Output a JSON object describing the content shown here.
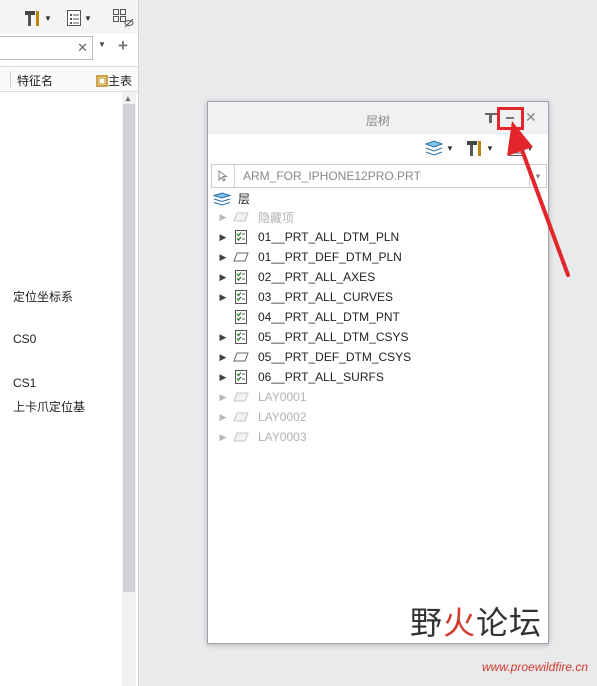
{
  "left_panel": {
    "column_feature_label": "特征名",
    "column_main_label": "主表",
    "items": [
      "定位坐标系",
      "CS0",
      "CS1",
      "上卡爪定位基"
    ]
  },
  "dialog": {
    "title": "层树",
    "model_name": "ARM_FOR_IPHONE12PRO.PRT",
    "root_label": "层",
    "layers": [
      {
        "label": "隐藏项",
        "expandable": true,
        "dimmed": true,
        "icon": "plane-icon"
      },
      {
        "label": "01__PRT_ALL_DTM_PLN",
        "expandable": true,
        "dimmed": false,
        "icon": "layer-rule-icon"
      },
      {
        "label": "01__PRT_DEF_DTM_PLN",
        "expandable": true,
        "dimmed": false,
        "icon": "plane-icon"
      },
      {
        "label": "02__PRT_ALL_AXES",
        "expandable": true,
        "dimmed": false,
        "icon": "layer-rule-icon"
      },
      {
        "label": "03__PRT_ALL_CURVES",
        "expandable": true,
        "dimmed": false,
        "icon": "layer-rule-icon"
      },
      {
        "label": "04__PRT_ALL_DTM_PNT",
        "expandable": false,
        "dimmed": false,
        "icon": "layer-rule-icon"
      },
      {
        "label": "05__PRT_ALL_DTM_CSYS",
        "expandable": true,
        "dimmed": false,
        "icon": "layer-rule-icon"
      },
      {
        "label": "05__PRT_DEF_DTM_CSYS",
        "expandable": true,
        "dimmed": false,
        "icon": "plane-icon"
      },
      {
        "label": "06__PRT_ALL_SURFS",
        "expandable": true,
        "dimmed": false,
        "icon": "layer-rule-icon"
      },
      {
        "label": "LAY0001",
        "expandable": true,
        "dimmed": true,
        "icon": "plane-icon"
      },
      {
        "label": "LAY0002",
        "expandable": true,
        "dimmed": true,
        "icon": "plane-icon"
      },
      {
        "label": "LAY0003",
        "expandable": true,
        "dimmed": true,
        "icon": "plane-icon"
      }
    ]
  },
  "annotation": {
    "color": "#e3262c"
  },
  "watermark": {
    "cn_part1": "野",
    "cn_part2": "火",
    "cn_part3": "论坛",
    "url": "www.proewildfire.cn"
  }
}
